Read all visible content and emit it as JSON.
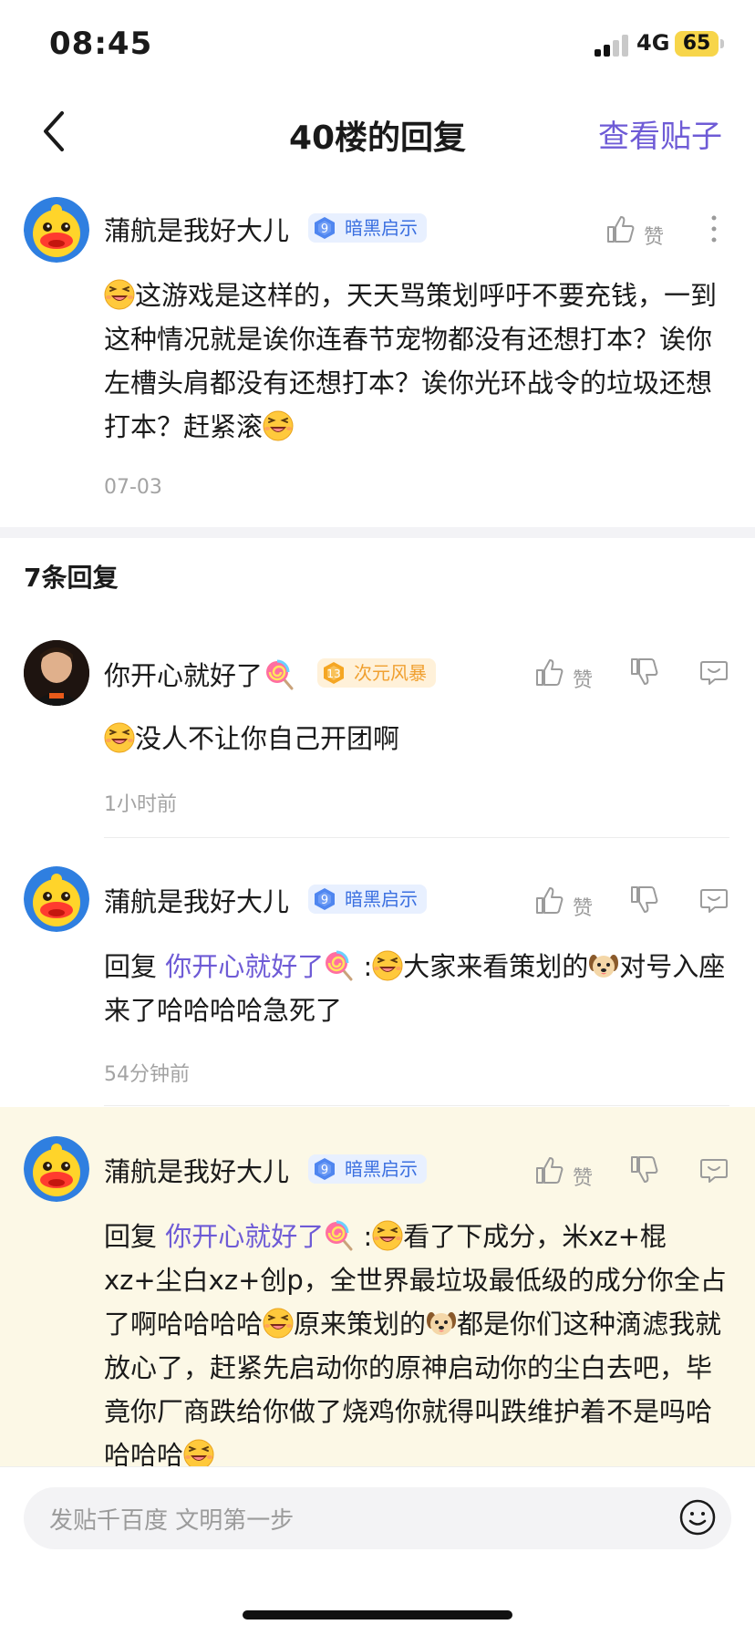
{
  "status": {
    "time": "08:45",
    "network": "4G",
    "battery": "65"
  },
  "nav": {
    "title": "40楼的回复",
    "right": "查看贴子"
  },
  "main_post": {
    "username": "蒲航是我好大儿",
    "badge_level": "9",
    "badge_text": "暗黑启示",
    "like_label": "赞",
    "content_1": "这游戏是这样的，天天骂策划呼吁不要充钱，一到这种情况就是诶你连春节宠物都没有还想打本？诶你左槽头肩都没有还想打本？诶你光环战令的垃圾还想打本？赶紧滚",
    "time": "07-03"
  },
  "replies_count": "7条回复",
  "replies": [
    {
      "username": "你开心就好了",
      "badge_level": "13",
      "badge_text": "次元风暴",
      "like_label": "赞",
      "content": "没人不让你自己开团啊",
      "time": "1小时前"
    },
    {
      "username": "蒲航是我好大儿",
      "badge_level": "9",
      "badge_text": "暗黑启示",
      "like_label": "赞",
      "reply_prefix": "回复 ",
      "reply_to": "你开心就好了",
      "colon": " :",
      "content_a": "大家来看策划的",
      "content_b": "对号入座来了哈哈哈哈急死了",
      "time": "54分钟前"
    },
    {
      "username": "蒲航是我好大儿",
      "badge_level": "9",
      "badge_text": "暗黑启示",
      "like_label": "赞",
      "reply_prefix": "回复 ",
      "reply_to": "你开心就好了",
      "colon": " :",
      "content_a": "看了下成分，米xz+棍xz+尘白xz+创p，全世界最垃圾最低级的成分你全占了啊哈哈哈哈",
      "content_b": "原来策划的",
      "content_c": "都是你们这种滴滤我就放心了，赶紧先启动你的原神启动你的尘白去吧，毕竟你厂商跌给你做了烧鸡你就得叫跌维护着不是吗哈哈哈哈"
    }
  ],
  "input": {
    "placeholder": "发贴千百度 文明第一步"
  },
  "colors": {
    "accent": "#6e5bd6",
    "highlight_bg": "#fcf8e6"
  }
}
